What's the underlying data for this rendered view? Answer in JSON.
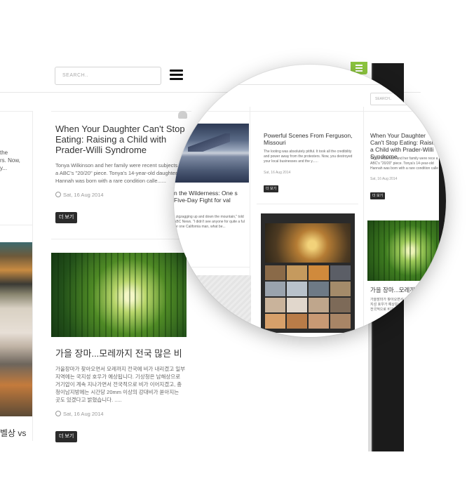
{
  "header": {
    "search_placeholder": "SEARCH.."
  },
  "left_column": {
    "snippets": [
      "the",
      "rs. Now,",
      "y..."
    ],
    "korean_title_fragment": "벨상 vs"
  },
  "posts": [
    {
      "title": "When Your Daughter Can't Stop Eating: Raising a Child with Prader-Willi Syndrome",
      "excerpt": "Tonya Wilkinson and her family were recent subjects of a ABC's \"20/20\" piece. Tonya's 14-year-old daughter Hannah was born with a rare condition calle......",
      "date": "Sat, 16 Aug 2014",
      "more_label": "더 보기"
    },
    {
      "title": "가을 장마...모레까지 전국 많은 비",
      "excerpt": "가을장마가 찾아오면서 모레까지 전국에 비가 내리겠고 일부 지역에는 국지성 호우가 예상됩니다. 기상청은 남해상으로 거기압이 계속 지나가면서 전국적으로 비가 이어지겠고, 충청이남지방에는 시간당 20mm 이상의 강대비가 쏟아지는 곳도 있겠다고 밝혔습니다. .....",
      "date": "Sat, 16 Aug 2014",
      "more_label": "더 보기"
    }
  ],
  "magnifier": {
    "search_placeholder": "SEARCH..",
    "col1": {
      "title": "n the Wilderness: One s Five-Day Fight for val",
      "excerpt": "t zigzagging up and down the mountain,\" told ABC News. \"I didn't see anyone for quite a ful for one California man, what be..."
    },
    "col2": {
      "title": "Powerful Scenes From Ferguson, Missouri",
      "excerpt": "The looting was absolutely pitiful. It took all the credibility and power away from the protesters. Now, you destroyed your local businesses and the y......",
      "date": "Sat, 16 Aug 2014",
      "more_label": "더 보기"
    },
    "col3": {
      "title": "When Your Daughter Can't Stop Eating: Raising a Child with Prader-Willi Syndrome",
      "excerpt": "Tonya Wilkinson and her family were rece a ABC's \"20/20\" piece. Tonya's 14-year-old Hannah was born with a rare condition calle",
      "date": "Sat, 16 Aug 2014",
      "more_label": "더 보기",
      "korean_title": "가을 장마...모레까지",
      "korean_excerpt": "가을장마가 찾아오면서 모레까지 전 역에는 국지성 호우가 예상됩니다. 기 이 계속 지나가면서 전국적으로 비가"
    }
  }
}
